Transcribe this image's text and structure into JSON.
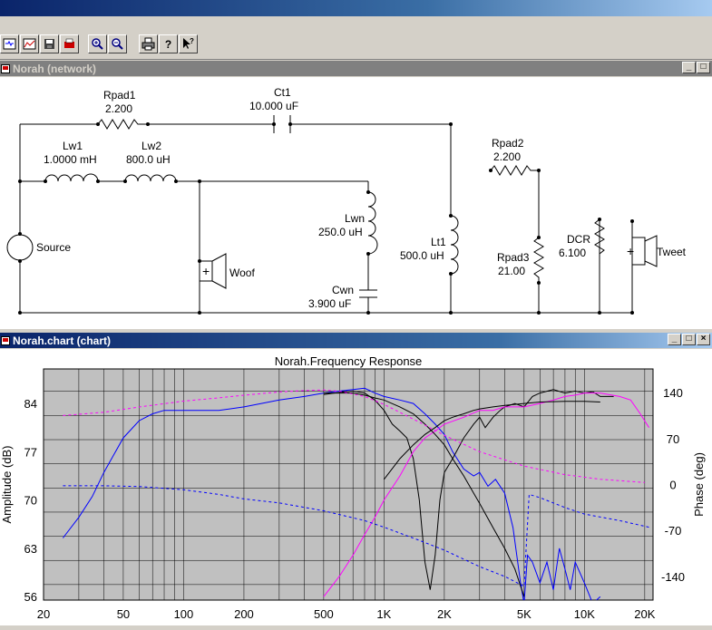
{
  "toolbar": {
    "buttons": [
      "network-view",
      "chart-view",
      "save",
      "print-setup",
      "zoom-in",
      "zoom-out",
      "print",
      "help",
      "context-help"
    ],
    "help_label": "?"
  },
  "network_window": {
    "title": "Norah (network)",
    "components": {
      "rpad1": {
        "name": "Rpad1",
        "value": "2.200"
      },
      "ct1": {
        "name": "Ct1",
        "value": "10.000 uF"
      },
      "lw1": {
        "name": "Lw1",
        "value": "1.0000 mH"
      },
      "lw2": {
        "name": "Lw2",
        "value": "800.0 uH"
      },
      "lwn": {
        "name": "Lwn",
        "value": "250.0 uH"
      },
      "cwn": {
        "name": "Cwn",
        "value": "3.900 uF"
      },
      "lt1": {
        "name": "Lt1",
        "value": "500.0 uH"
      },
      "rpad2": {
        "name": "Rpad2",
        "value": "2.200"
      },
      "rpad3": {
        "name": "Rpad3",
        "value": "21.00"
      },
      "dcr": {
        "name": "DCR",
        "value": "6.100"
      },
      "source": {
        "name": "Source"
      },
      "woof": {
        "name": "Woof"
      },
      "tweet": {
        "name": "Tweet"
      }
    }
  },
  "chart_window": {
    "title": "Norah.chart (chart)",
    "window_buttons": [
      "_",
      "□",
      "×"
    ]
  },
  "colors": {
    "accent_blue": "#0000ff",
    "magenta": "#ff00ff",
    "grid_bg": "#c0c0c0"
  },
  "chart_data": {
    "type": "line",
    "title": "Norah.Frequency Response",
    "xlabel": "",
    "ylabel": "Amplitude (dB)",
    "y2label": "Phase (deg)",
    "xscale": "log",
    "xlim": [
      20,
      22000
    ],
    "ylim": [
      55.5,
      89
    ],
    "y2lim": [
      -176,
      176
    ],
    "x_ticks": [
      "20",
      "50",
      "100",
      "200",
      "500",
      "1K",
      "2K",
      "5K",
      "10K",
      "20K"
    ],
    "x_tick_values": [
      20,
      50,
      100,
      200,
      500,
      1000,
      2000,
      5000,
      10000,
      20000
    ],
    "y_ticks": [
      56,
      63,
      70,
      77,
      84
    ],
    "y2_ticks": [
      140,
      70,
      0,
      -70,
      -140
    ],
    "series": [
      {
        "color": "#0000ff",
        "style": "solid",
        "axis": "left",
        "x": [
          25,
          30,
          35,
          40,
          50,
          60,
          70,
          80,
          100,
          150,
          200,
          300,
          400,
          500,
          600,
          700,
          800,
          900,
          1000,
          1200,
          1400,
          1600,
          1800,
          2000,
          2200,
          2500,
          2800,
          3000,
          3300,
          3600,
          4000,
          4400,
          4800,
          5000,
          5200,
          5500,
          6000,
          6500,
          7000,
          7500,
          8000,
          8500,
          9000,
          10000,
          11000,
          12000
        ],
        "y": [
          64.5,
          67.5,
          70.5,
          74,
          79,
          81.5,
          82.5,
          83,
          83,
          83,
          83.5,
          84.5,
          85,
          85.5,
          85.8,
          86,
          86.2,
          85.5,
          85,
          84.5,
          84,
          82.5,
          81,
          79.5,
          77,
          74.5,
          73.5,
          74,
          72,
          73,
          71,
          66,
          58,
          55,
          62,
          61,
          58,
          61,
          57,
          63,
          60,
          57,
          61,
          58,
          55,
          56
        ]
      },
      {
        "color": "#000000",
        "style": "solid",
        "axis": "left",
        "x": [
          500,
          600,
          700,
          800,
          900,
          1000,
          1100,
          1200,
          1300,
          1400,
          1500,
          1600,
          1700,
          1800,
          1900,
          2000,
          2200,
          2500,
          2800,
          3000,
          3200,
          3500,
          3800,
          4000,
          4500,
          5000,
          5500,
          6000,
          7000,
          8000,
          9000,
          10000,
          11000,
          12000,
          14000
        ],
        "y": [
          85.3,
          85.6,
          85.8,
          85.5,
          84.5,
          83,
          81,
          80,
          79,
          76,
          70,
          61,
          57,
          62,
          70,
          74,
          76,
          79,
          81,
          82,
          80.5,
          82,
          83,
          83.5,
          84,
          83.5,
          85,
          85.5,
          86,
          85.5,
          85.8,
          85.5,
          85.7,
          85,
          85
        ]
      },
      {
        "color": "#ff00ff",
        "style": "solid",
        "axis": "left",
        "x": [
          500,
          600,
          700,
          800,
          900,
          1000,
          1200,
          1400,
          1600,
          1800,
          2000,
          2500,
          3000,
          3500,
          4000,
          5000,
          6000,
          7000,
          8000,
          9000,
          10000,
          12000,
          15000,
          17000,
          19000,
          21000
        ],
        "y": [
          56,
          59,
          62,
          65,
          67.5,
          70,
          73.5,
          77,
          79,
          80,
          81,
          82,
          83,
          83,
          83.5,
          83.5,
          84,
          84.5,
          85,
          85.2,
          85.5,
          85.5,
          85,
          84.5,
          82.5,
          80.5
        ]
      },
      {
        "color": "#000000",
        "style": "solid",
        "axis": "left",
        "x": [
          500,
          600,
          700,
          800,
          900,
          1000,
          1200,
          1400,
          1600,
          1800,
          2000,
          2200,
          2500,
          2800,
          3000,
          3500,
          4000,
          4500,
          5000
        ],
        "y": [
          85.5,
          85.5,
          85.5,
          85.2,
          84.8,
          84.5,
          83.5,
          82.5,
          81,
          79.5,
          78,
          76,
          73.5,
          71,
          69.5,
          66,
          63,
          60,
          56
        ]
      },
      {
        "color": "#000000",
        "style": "solid",
        "axis": "left",
        "x": [
          1000,
          1200,
          1400,
          1600,
          1800,
          2000,
          2200,
          2500,
          2800,
          3000,
          3500,
          4000,
          5000,
          6000,
          8000,
          10000,
          12000
        ],
        "y": [
          73,
          76,
          78,
          79.5,
          80.5,
          81.5,
          82,
          82.5,
          83,
          83.2,
          83.5,
          83.7,
          84,
          84.2,
          84.3,
          84.3,
          84.2
        ]
      },
      {
        "color": "#ff00ff",
        "style": "dashed",
        "axis": "right",
        "x": [
          25,
          40,
          60,
          100,
          150,
          200,
          300,
          400,
          500,
          600,
          800,
          1000,
          1500,
          2000,
          3000,
          5000,
          8000,
          12000,
          20000
        ],
        "y": [
          105,
          110,
          118,
          127,
          132,
          136,
          141,
          143,
          144,
          142,
          134,
          122,
          95,
          75,
          50,
          28,
          15,
          8,
          3
        ]
      },
      {
        "color": "#0000ff",
        "style": "dashed",
        "axis": "right",
        "x": [
          25,
          40,
          60,
          100,
          150,
          200,
          300,
          500,
          800,
          1000,
          1500,
          2000,
          3000,
          4000,
          5000,
          5300,
          6000,
          8000,
          10000,
          15000,
          21000
        ],
        "y": [
          -2,
          -2,
          -3,
          -8,
          -15,
          -22,
          -28,
          -40,
          -55,
          -65,
          -85,
          -100,
          -125,
          -140,
          -155,
          -15,
          -20,
          -35,
          -45,
          -55,
          -65
        ]
      }
    ]
  }
}
